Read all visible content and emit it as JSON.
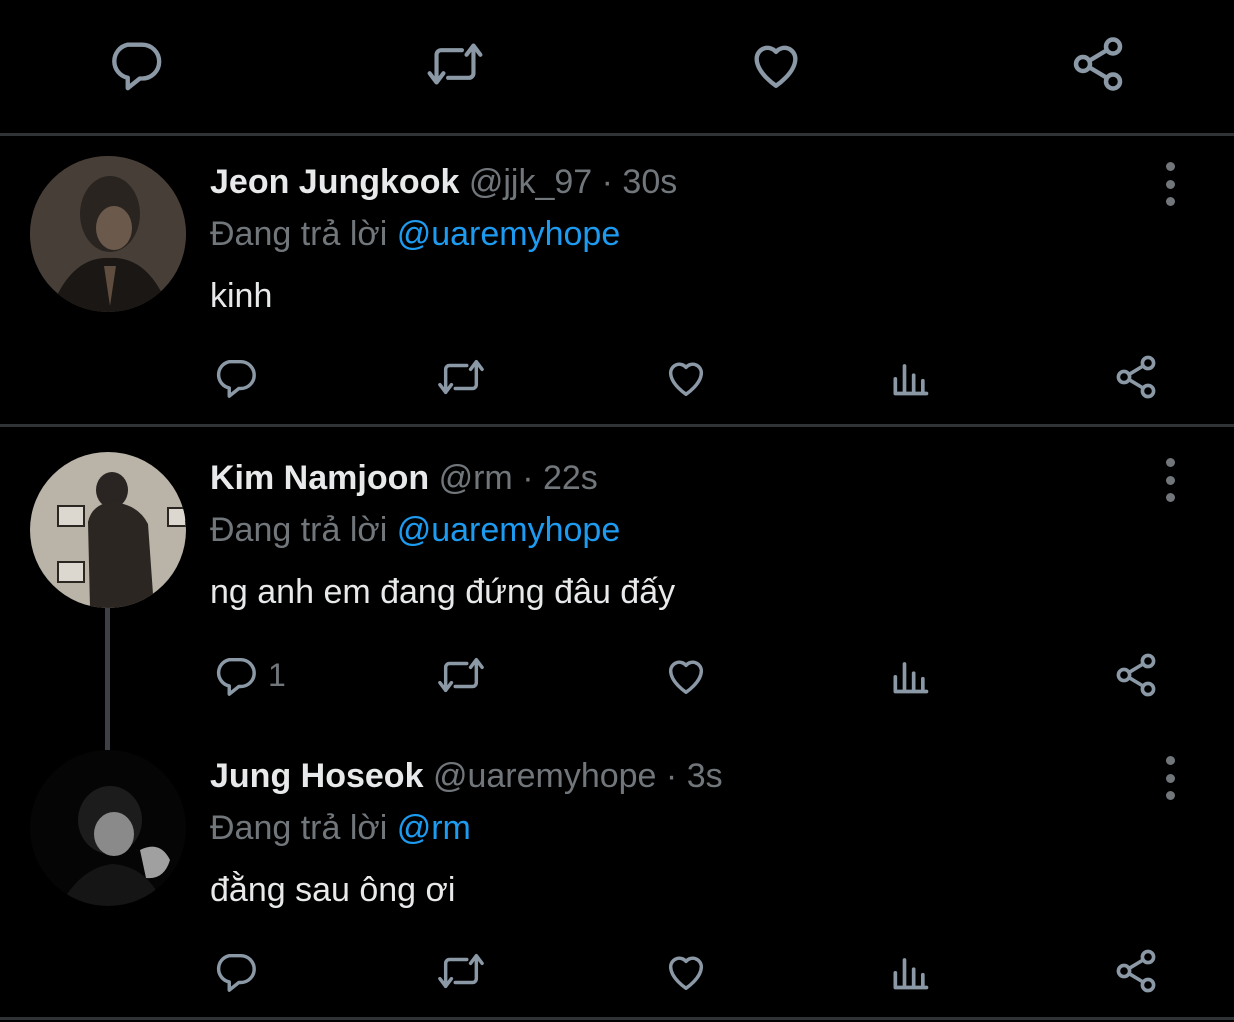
{
  "top_actions": {
    "icons": [
      "reply-icon",
      "retweet-icon",
      "like-icon",
      "share-icon"
    ]
  },
  "tweets": [
    {
      "name": "Jeon Jungkook",
      "handle": "@jjk_97",
      "dot": "·",
      "time": "30s",
      "reply_prefix": "Đang trả lời",
      "reply_to": "@uaremyhope",
      "text": "kinh",
      "reply_count": ""
    },
    {
      "name": "Kim Namjoon",
      "handle": "@rm",
      "dot": "·",
      "time": "22s",
      "reply_prefix": "Đang trả lời",
      "reply_to": "@uaremyhope",
      "text": "ng anh em đang đứng đâu đấy",
      "reply_count": "1"
    },
    {
      "name": "Jung Hoseok",
      "handle": "@uaremyhope",
      "dot": "·",
      "time": "3s",
      "reply_prefix": "Đang trả lời",
      "reply_to": "@rm",
      "text": "đằng sau ông ơi",
      "reply_count": ""
    }
  ],
  "colors": {
    "background": "#000000",
    "text": "#e7e9ea",
    "muted": "#71767b",
    "link": "#1d9bf0",
    "divider": "#2f3336"
  }
}
